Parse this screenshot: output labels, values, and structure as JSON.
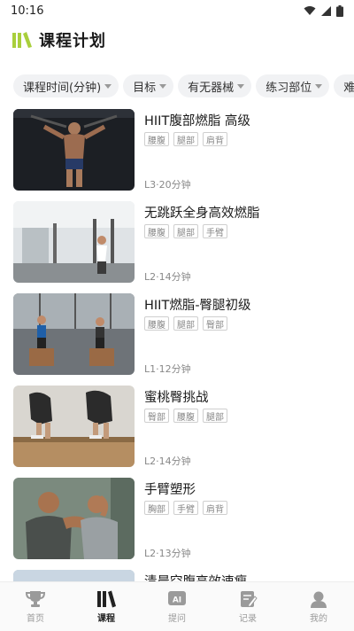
{
  "status": {
    "time": "10:16"
  },
  "header": {
    "title": "课程计划"
  },
  "filters": [
    {
      "label": "课程时间(分钟)"
    },
    {
      "label": "目标"
    },
    {
      "label": "有无器械"
    },
    {
      "label": "练习部位"
    },
    {
      "label": "难度"
    }
  ],
  "courses": [
    {
      "title": "HIIT腹部燃脂 高级",
      "tags": [
        "腰腹",
        "腿部",
        "肩背"
      ],
      "meta": "L3·20分钟"
    },
    {
      "title": "无跳跃全身高效燃脂",
      "tags": [
        "腰腹",
        "腿部",
        "手臂"
      ],
      "meta": "L2·14分钟"
    },
    {
      "title": "HIIT燃脂-臀腿初级",
      "tags": [
        "腰腹",
        "腿部",
        "臀部"
      ],
      "meta": "L1·12分钟"
    },
    {
      "title": "蜜桃臀挑战",
      "tags": [
        "臀部",
        "腰腹",
        "腿部"
      ],
      "meta": "L2·14分钟"
    },
    {
      "title": "手臂塑形",
      "tags": [
        "胸部",
        "手臂",
        "肩背"
      ],
      "meta": "L2·13分钟"
    },
    {
      "title": "清晨空腹高效速瘦",
      "tags": [],
      "meta": ""
    }
  ],
  "tabbar": {
    "items": [
      {
        "label": "首页",
        "icon": "trophy-icon"
      },
      {
        "label": "课程",
        "icon": "course-icon"
      },
      {
        "label": "提问",
        "icon": "ai-icon"
      },
      {
        "label": "记录",
        "icon": "record-icon"
      },
      {
        "label": "我的",
        "icon": "user-icon"
      }
    ],
    "active_index": 1
  },
  "colors": {
    "accent": "#b5d94a",
    "text": "#1a1a1a",
    "muted": "#888888"
  }
}
